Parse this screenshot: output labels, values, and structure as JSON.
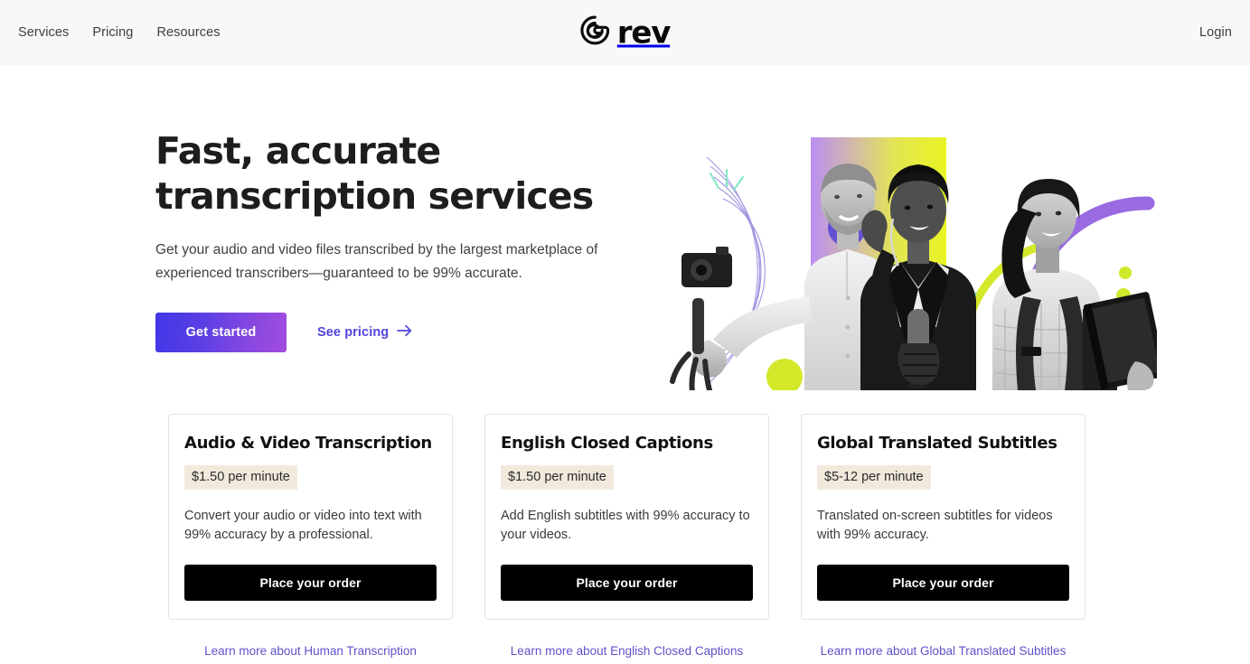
{
  "header": {
    "nav": [
      {
        "label": "Services",
        "name": "nav-services"
      },
      {
        "label": "Pricing",
        "name": "nav-pricing"
      },
      {
        "label": "Resources",
        "name": "nav-resources"
      }
    ],
    "logo_text": "rev",
    "logo_icon": "rev-spiral-icon",
    "login_label": "Login",
    "background": "#f8f8f8"
  },
  "hero": {
    "title": "Fast, accurate transcription services",
    "subtitle": "Get your audio and video files transcribed by the largest marketplace of experienced transcribers—guaranteed to be 99% accurate.",
    "primary_cta": "Get started",
    "secondary_cta": "See pricing",
    "secondary_cta_icon": "arrow-right-icon",
    "primary_gradient_from": "#4136e6",
    "primary_gradient_to": "#a04ddd",
    "link_color": "#5146dd",
    "artwork": {
      "alt": "Three people: a man holding a camera on a tripod grip, a woman with a microphone and headphones, and a woman with a backpack holding a book",
      "gradient_from": "#b388e8",
      "gradient_to": "#e9f424",
      "accent_purple": "#8b5cf6",
      "accent_green": "#c8e81e",
      "accent_teal": "#7fe5c4"
    }
  },
  "cards": [
    {
      "title": "Audio & Video Transcription",
      "price": "$1.50 per minute",
      "description": "Convert your audio or video into text with 99% accuracy by a professional.",
      "cta": "Place your order",
      "learn_more": "Learn more about Human Transcription"
    },
    {
      "title": "English Closed Captions",
      "price": "$1.50 per minute",
      "description": "Add English subtitles with 99% accuracy to your videos.",
      "cta": "Place your order",
      "learn_more": "Learn more about English Closed Captions"
    },
    {
      "title": "Global Translated Subtitles",
      "price": "$5-12 per minute",
      "description": "Translated on-screen subtitles for videos with 99% accuracy.",
      "cta": "Place your order",
      "learn_more": "Learn more about Global Translated Subtitles"
    }
  ],
  "theme": {
    "price_badge_bg": "#f2e9dd",
    "card_border": "#e3e3e3",
    "cta_bg": "#000000",
    "learn_link_color": "#5f52c9"
  }
}
